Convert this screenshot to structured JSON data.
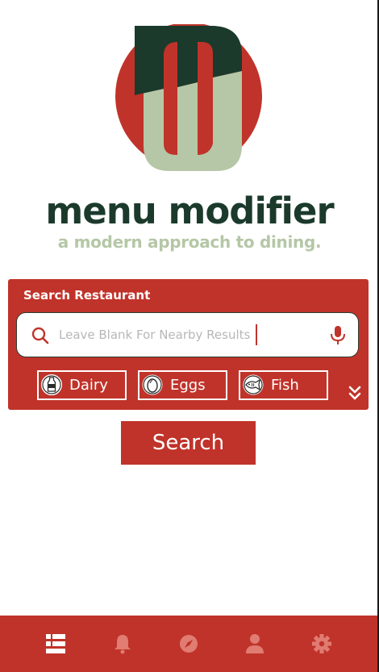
{
  "brand": {
    "title": "menu modifier",
    "tagline": "a modern approach to dining.",
    "logo_icon": "mw-monogram-logo"
  },
  "search_panel": {
    "title": "Search Restaurant",
    "search_field": {
      "value": "",
      "placeholder": "Leave Blank For Nearby Results",
      "left_icon": "search-icon",
      "right_icon": "microphone-icon"
    },
    "filters": [
      {
        "label": "Dairy",
        "icon": "milk-bottle-icon"
      },
      {
        "label": "Eggs",
        "icon": "egg-icon"
      },
      {
        "label": "Fish",
        "icon": "fish-icon"
      }
    ],
    "expand_icon": "double-chevron-down-icon"
  },
  "search_button": {
    "label": "Search"
  },
  "tab_bar": {
    "tabs": [
      {
        "icon": "list-icon",
        "active": true
      },
      {
        "icon": "bell-icon",
        "active": false
      },
      {
        "icon": "compass-icon",
        "active": false
      },
      {
        "icon": "user-icon",
        "active": false
      },
      {
        "icon": "gear-icon",
        "active": false
      }
    ]
  },
  "colors": {
    "brand_red": "#c0332a",
    "brand_dark_green": "#1b3a2c",
    "brand_sage": "#b5c7a6",
    "tab_inactive": "#e07c72",
    "white": "#ffffff"
  }
}
